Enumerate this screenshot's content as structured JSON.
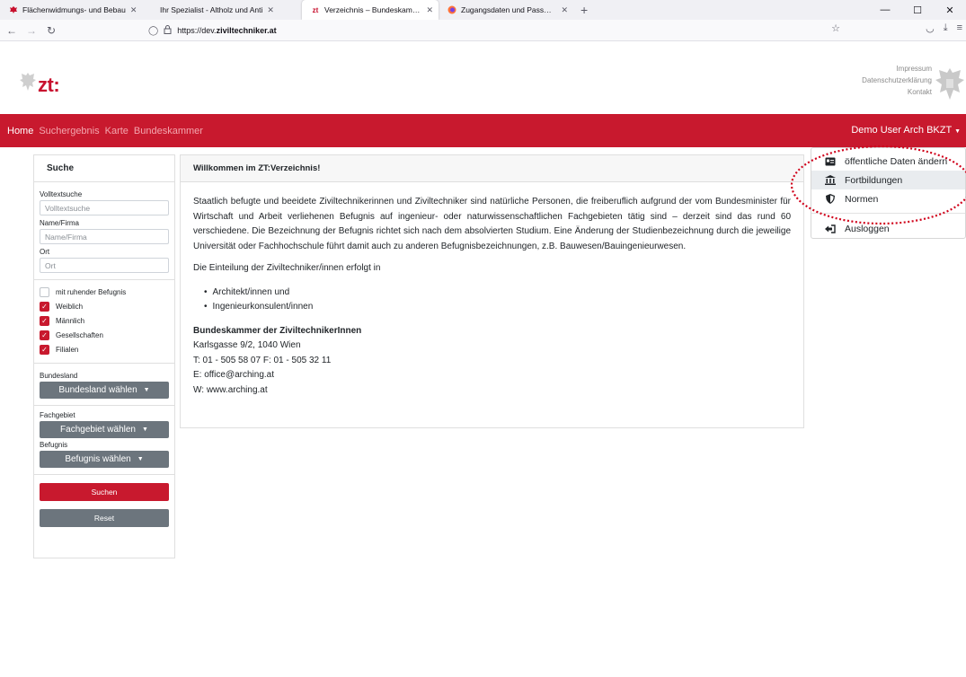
{
  "browser": {
    "tabs": [
      {
        "label": "Flächenwidmungs- und Bebau",
        "favicon": "red-eagle",
        "active": false
      },
      {
        "label": "Ihr Spezialist - Altholz und Anti",
        "favicon": "none",
        "active": false
      },
      {
        "label": "Verzeichnis – Bundeskammer de",
        "favicon": "zt",
        "active": true
      },
      {
        "label": "Zugangsdaten und Passwörter",
        "favicon": "firefox",
        "active": false
      }
    ],
    "new_tab": "+",
    "url": "https://dev.",
    "url_domain": "ziviltechniker.at",
    "window_controls": {
      "minimize": "—",
      "maximize": "☐",
      "close": "✕"
    }
  },
  "site": {
    "logo_text": "zt:",
    "top_links": [
      "Impressum",
      "Datenschutzerklärung",
      "Kontakt"
    ],
    "nav": [
      "Home",
      "Suchergebnis",
      "Karte",
      "Bundeskammer"
    ],
    "user_menu": "Demo User Arch BKZT"
  },
  "dropdown": {
    "items": [
      {
        "label": "öffentliche Daten ändern",
        "icon": "id-card-icon"
      },
      {
        "label": "Fortbildungen",
        "icon": "bank-icon"
      },
      {
        "label": "Normen",
        "icon": "shield-icon"
      },
      {
        "label": "Ausloggen",
        "icon": "sign-out-icon"
      }
    ]
  },
  "sidebar": {
    "title": "Suche",
    "volltext_label": "Volltextsuche",
    "volltext_placeholder": "Volltextsuche",
    "name_label": "Name/Firma",
    "name_placeholder": "Name/Firma",
    "ort_label": "Ort",
    "ort_placeholder": "Ort",
    "checkboxes": [
      {
        "label": "mit ruhender Befugnis",
        "checked": false
      },
      {
        "label": "Weiblich",
        "checked": true
      },
      {
        "label": "Männlich",
        "checked": true
      },
      {
        "label": "Gesellschaften",
        "checked": true
      },
      {
        "label": "Filialen",
        "checked": true
      }
    ],
    "bundesland_label": "Bundesland",
    "bundesland_button": "Bundesland wählen",
    "fachgebiet_label": "Fachgebiet",
    "fachgebiet_button": "Fachgebiet wählen",
    "befugnis_label": "Befugnis",
    "befugnis_button": "Befugnis wählen",
    "search_button": "Suchen",
    "reset_button": "Reset"
  },
  "main": {
    "title": "Willkommen im ZT:Verzeichnis!",
    "paragraph1": "Staatlich befugte und beeidete Ziviltechnikerinnen und Ziviltechniker sind natürliche Personen, die freiberuflich aufgrund der vom Bundesminister für Wirtschaft und Arbeit verliehenen Befugnis auf ingenieur- oder naturwissenschaftlichen Fachgebieten tätig sind – derzeit sind das rund 60 verschiedene. Die Bezeichnung der Befugnis richtet sich nach dem absolvierten Studium. Eine Änderung der Studienbezeichnung durch die jeweilige Universität oder Fachhochschule führt damit auch zu anderen Befugnisbezeichnungen, z.B. Bauwesen/Bauingenieurwesen.",
    "paragraph2": "Die Einteilung der Ziviltechniker/innen erfolgt in",
    "list": [
      "Architekt/innen und",
      "Ingenieurkonsulent/innen"
    ],
    "contact_title": "Bundeskammer der ZiviltechnikerInnen",
    "contact_lines": [
      "Karlsgasse 9/2, 1040 Wien",
      "T: 01 - 505 58 07 F: 01 - 505 32 11",
      "E: office@arching.at",
      "W: www.arching.at"
    ]
  },
  "colors": {
    "brand_red": "#c8192e",
    "gray_button": "#6c757d",
    "annotation_red": "#d0021b"
  }
}
